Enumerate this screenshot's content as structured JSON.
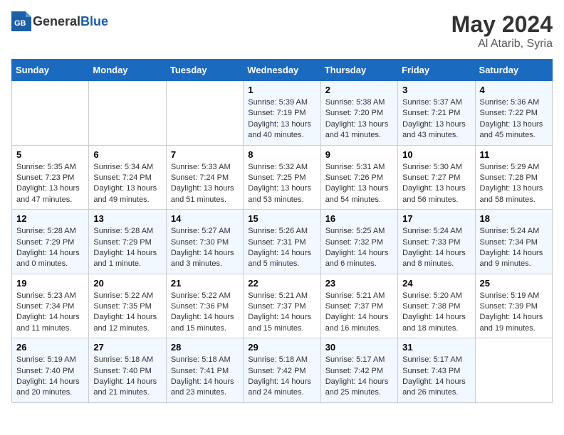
{
  "header": {
    "logo_general": "General",
    "logo_blue": "Blue",
    "month_year": "May 2024",
    "location": "Al Atarib, Syria"
  },
  "days_of_week": [
    "Sunday",
    "Monday",
    "Tuesday",
    "Wednesday",
    "Thursday",
    "Friday",
    "Saturday"
  ],
  "weeks": [
    [
      {
        "day": "",
        "info": ""
      },
      {
        "day": "",
        "info": ""
      },
      {
        "day": "",
        "info": ""
      },
      {
        "day": "1",
        "info": "Sunrise: 5:39 AM\nSunset: 7:19 PM\nDaylight: 13 hours and 40 minutes."
      },
      {
        "day": "2",
        "info": "Sunrise: 5:38 AM\nSunset: 7:20 PM\nDaylight: 13 hours and 41 minutes."
      },
      {
        "day": "3",
        "info": "Sunrise: 5:37 AM\nSunset: 7:21 PM\nDaylight: 13 hours and 43 minutes."
      },
      {
        "day": "4",
        "info": "Sunrise: 5:36 AM\nSunset: 7:22 PM\nDaylight: 13 hours and 45 minutes."
      }
    ],
    [
      {
        "day": "5",
        "info": "Sunrise: 5:35 AM\nSunset: 7:23 PM\nDaylight: 13 hours and 47 minutes."
      },
      {
        "day": "6",
        "info": "Sunrise: 5:34 AM\nSunset: 7:24 PM\nDaylight: 13 hours and 49 minutes."
      },
      {
        "day": "7",
        "info": "Sunrise: 5:33 AM\nSunset: 7:24 PM\nDaylight: 13 hours and 51 minutes."
      },
      {
        "day": "8",
        "info": "Sunrise: 5:32 AM\nSunset: 7:25 PM\nDaylight: 13 hours and 53 minutes."
      },
      {
        "day": "9",
        "info": "Sunrise: 5:31 AM\nSunset: 7:26 PM\nDaylight: 13 hours and 54 minutes."
      },
      {
        "day": "10",
        "info": "Sunrise: 5:30 AM\nSunset: 7:27 PM\nDaylight: 13 hours and 56 minutes."
      },
      {
        "day": "11",
        "info": "Sunrise: 5:29 AM\nSunset: 7:28 PM\nDaylight: 13 hours and 58 minutes."
      }
    ],
    [
      {
        "day": "12",
        "info": "Sunrise: 5:28 AM\nSunset: 7:29 PM\nDaylight: 14 hours and 0 minutes."
      },
      {
        "day": "13",
        "info": "Sunrise: 5:28 AM\nSunset: 7:29 PM\nDaylight: 14 hours and 1 minute."
      },
      {
        "day": "14",
        "info": "Sunrise: 5:27 AM\nSunset: 7:30 PM\nDaylight: 14 hours and 3 minutes."
      },
      {
        "day": "15",
        "info": "Sunrise: 5:26 AM\nSunset: 7:31 PM\nDaylight: 14 hours and 5 minutes."
      },
      {
        "day": "16",
        "info": "Sunrise: 5:25 AM\nSunset: 7:32 PM\nDaylight: 14 hours and 6 minutes."
      },
      {
        "day": "17",
        "info": "Sunrise: 5:24 AM\nSunset: 7:33 PM\nDaylight: 14 hours and 8 minutes."
      },
      {
        "day": "18",
        "info": "Sunrise: 5:24 AM\nSunset: 7:34 PM\nDaylight: 14 hours and 9 minutes."
      }
    ],
    [
      {
        "day": "19",
        "info": "Sunrise: 5:23 AM\nSunset: 7:34 PM\nDaylight: 14 hours and 11 minutes."
      },
      {
        "day": "20",
        "info": "Sunrise: 5:22 AM\nSunset: 7:35 PM\nDaylight: 14 hours and 12 minutes."
      },
      {
        "day": "21",
        "info": "Sunrise: 5:22 AM\nSunset: 7:36 PM\nDaylight: 14 hours and 15 minutes."
      },
      {
        "day": "22",
        "info": "Sunrise: 5:21 AM\nSunset: 7:37 PM\nDaylight: 14 hours and 15 minutes."
      },
      {
        "day": "23",
        "info": "Sunrise: 5:21 AM\nSunset: 7:37 PM\nDaylight: 14 hours and 16 minutes."
      },
      {
        "day": "24",
        "info": "Sunrise: 5:20 AM\nSunset: 7:38 PM\nDaylight: 14 hours and 18 minutes."
      },
      {
        "day": "25",
        "info": "Sunrise: 5:19 AM\nSunset: 7:39 PM\nDaylight: 14 hours and 19 minutes."
      }
    ],
    [
      {
        "day": "26",
        "info": "Sunrise: 5:19 AM\nSunset: 7:40 PM\nDaylight: 14 hours and 20 minutes."
      },
      {
        "day": "27",
        "info": "Sunrise: 5:18 AM\nSunset: 7:40 PM\nDaylight: 14 hours and 21 minutes."
      },
      {
        "day": "28",
        "info": "Sunrise: 5:18 AM\nSunset: 7:41 PM\nDaylight: 14 hours and 23 minutes."
      },
      {
        "day": "29",
        "info": "Sunrise: 5:18 AM\nSunset: 7:42 PM\nDaylight: 14 hours and 24 minutes."
      },
      {
        "day": "30",
        "info": "Sunrise: 5:17 AM\nSunset: 7:42 PM\nDaylight: 14 hours and 25 minutes."
      },
      {
        "day": "31",
        "info": "Sunrise: 5:17 AM\nSunset: 7:43 PM\nDaylight: 14 hours and 26 minutes."
      },
      {
        "day": "",
        "info": ""
      }
    ]
  ]
}
